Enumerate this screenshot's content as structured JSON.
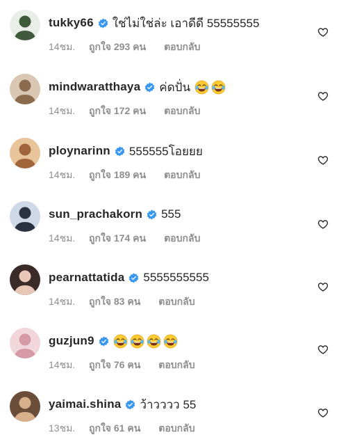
{
  "comments": [
    {
      "username": "tukky66",
      "text": "ใช่ไม่ใช่ล่ะ เอาดีดี 55555555",
      "emoji_count": 0,
      "time": "14ชม.",
      "likes": "ถูกใจ 293 คน",
      "reply": "ตอบกลับ",
      "avatar_bg": "#e9eee8",
      "avatar_fg": "#3f5a3a"
    },
    {
      "username": "mindwaratthaya",
      "text": "ค่ดปั่น",
      "emoji_count": 2,
      "time": "14ชม.",
      "likes": "ถูกใจ 172 คน",
      "reply": "ตอบกลับ",
      "avatar_bg": "#d9c7b3",
      "avatar_fg": "#8b6b4d"
    },
    {
      "username": "ploynarinn",
      "text": "555555โอยยย",
      "emoji_count": 0,
      "time": "14ชม.",
      "likes": "ถูกใจ 189 คน",
      "reply": "ตอบกลับ",
      "avatar_bg": "#e7c49a",
      "avatar_fg": "#a0653a"
    },
    {
      "username": "sun_prachakorn",
      "text": "555",
      "emoji_count": 0,
      "time": "14ชม.",
      "likes": "ถูกใจ 174 คน",
      "reply": "ตอบกลับ",
      "avatar_bg": "#cfd8e6",
      "avatar_fg": "#2a3142"
    },
    {
      "username": "pearnattatida",
      "text": "5555555555",
      "emoji_count": 0,
      "time": "14ชม.",
      "likes": "ถูกใจ 83 คน",
      "reply": "ตอบกลับ",
      "avatar_bg": "#3b2b28",
      "avatar_fg": "#e8c7b8"
    },
    {
      "username": "guzjun9",
      "text": "",
      "emoji_count": 4,
      "time": "14ชม.",
      "likes": "ถูกใจ 76 คน",
      "reply": "ตอบกลับ",
      "avatar_bg": "#f1d7dc",
      "avatar_fg": "#d69aa6"
    },
    {
      "username": "yaimai.shina",
      "text": "ว้าวววว 55",
      "emoji_count": 0,
      "time": "13ชม.",
      "likes": "ถูกใจ 61 คน",
      "reply": "ตอบกลับ",
      "avatar_bg": "#6b4e3a",
      "avatar_fg": "#d9b08c"
    }
  ],
  "icons": {
    "verified": "verified-badge-icon",
    "emoji": "face-with-tears-of-joy",
    "like": "heart-outline-icon"
  },
  "colors": {
    "verified": "#3897f0",
    "username": "#262626",
    "meta": "#8e8e8e"
  }
}
